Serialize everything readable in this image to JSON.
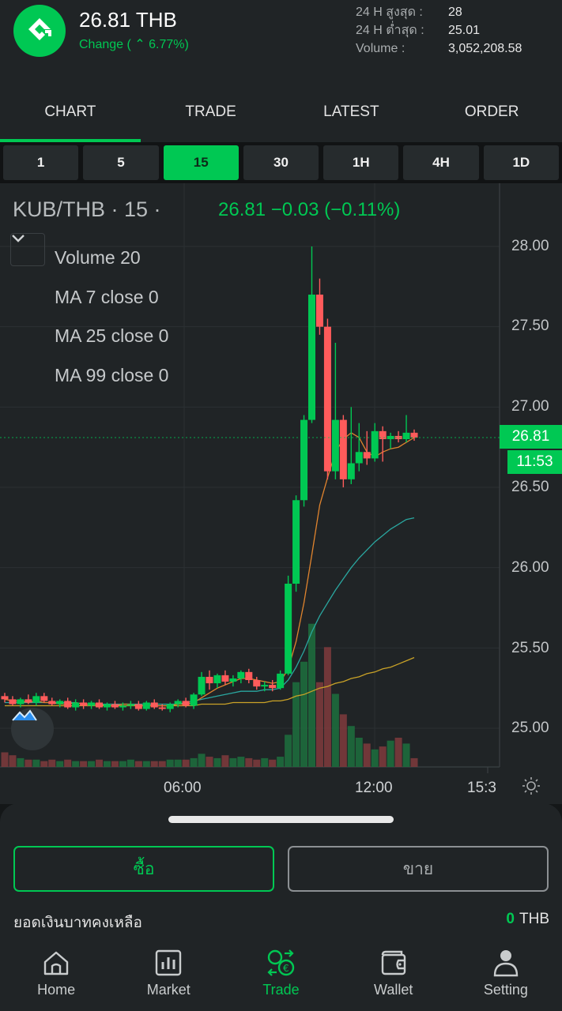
{
  "header": {
    "price": "26.81 THB",
    "change": "Change ( ⌃ 6.77%)",
    "stats": [
      {
        "label": "24 H สูงสุด :",
        "value": "28"
      },
      {
        "label": "24 H ต่ำสุด :",
        "value": "25.01"
      },
      {
        "label": "Volume :",
        "value": "3,052,208.58"
      }
    ]
  },
  "tabs": [
    {
      "label": "CHART",
      "active": true
    },
    {
      "label": "TRADE",
      "active": false
    },
    {
      "label": "LATEST",
      "active": false
    },
    {
      "label": "ORDER",
      "active": false
    }
  ],
  "intervals": [
    {
      "label": "1",
      "active": false
    },
    {
      "label": "5",
      "active": false
    },
    {
      "label": "15",
      "active": true
    },
    {
      "label": "30",
      "active": false
    },
    {
      "label": "1H",
      "active": false
    },
    {
      "label": "4H",
      "active": false
    },
    {
      "label": "1D",
      "active": false
    }
  ],
  "chart": {
    "symbol": "KUB/THB · 15 ·",
    "quote": "26.81  −0.03 (−0.11%)",
    "legend": [
      "Volume 20",
      "MA 7 close 0",
      "MA 25 close 0",
      "MA 99 close 0"
    ],
    "price_ticks": [
      "28.00",
      "27.50",
      "27.00",
      "26.50",
      "26.00",
      "25.50",
      "25.00"
    ],
    "last_price": "26.81",
    "countdown": "11:53",
    "time_ticks": [
      "06:00",
      "12:00",
      "15:3"
    ],
    "colors": {
      "up": "#00c853",
      "down": "#ff5b5b",
      "ma7": "#e0842e",
      "ma25": "#2aa7a0",
      "ma99": "#c9a227"
    }
  },
  "chart_data": {
    "type": "candlestick",
    "title": "KUB/THB",
    "interval": "15",
    "ylim": [
      24.75,
      28.15
    ],
    "y_ticks": [
      25.0,
      25.5,
      26.0,
      26.5,
      27.0,
      27.5,
      28.0
    ],
    "x_ticks": [
      "06:00",
      "12:00",
      "15:3"
    ],
    "last_price": 26.81,
    "candles": [
      [
        25.2,
        25.22,
        25.16,
        25.18
      ],
      [
        25.18,
        25.2,
        25.14,
        25.15
      ],
      [
        25.15,
        25.19,
        25.13,
        25.18
      ],
      [
        25.18,
        25.21,
        25.15,
        25.16
      ],
      [
        25.16,
        25.22,
        25.14,
        25.2
      ],
      [
        25.2,
        25.22,
        25.16,
        25.17
      ],
      [
        25.17,
        25.19,
        25.14,
        25.15
      ],
      [
        25.15,
        25.18,
        25.13,
        25.17
      ],
      [
        25.17,
        25.19,
        25.12,
        25.13
      ],
      [
        25.13,
        25.18,
        25.11,
        25.16
      ],
      [
        25.16,
        25.18,
        25.12,
        25.14
      ],
      [
        25.14,
        25.17,
        25.12,
        25.16
      ],
      [
        25.16,
        25.18,
        25.12,
        25.13
      ],
      [
        25.13,
        25.16,
        25.11,
        25.15
      ],
      [
        25.15,
        25.17,
        25.12,
        25.13
      ],
      [
        25.13,
        25.16,
        25.11,
        25.14
      ],
      [
        25.14,
        25.17,
        25.12,
        25.15
      ],
      [
        25.15,
        25.17,
        25.11,
        25.12
      ],
      [
        25.12,
        25.17,
        25.11,
        25.16
      ],
      [
        25.16,
        25.18,
        25.12,
        25.13
      ],
      [
        25.13,
        25.15,
        25.11,
        25.12
      ],
      [
        25.12,
        25.16,
        25.1,
        25.15
      ],
      [
        25.15,
        25.18,
        25.13,
        25.17
      ],
      [
        25.17,
        25.19,
        25.13,
        25.14
      ],
      [
        25.14,
        25.22,
        25.12,
        25.21
      ],
      [
        25.21,
        25.35,
        25.2,
        25.32
      ],
      [
        25.32,
        25.36,
        25.24,
        25.28
      ],
      [
        25.28,
        25.34,
        25.25,
        25.33
      ],
      [
        25.33,
        25.36,
        25.27,
        25.29
      ],
      [
        25.29,
        25.33,
        25.26,
        25.31
      ],
      [
        25.31,
        25.36,
        25.28,
        25.35
      ],
      [
        25.35,
        25.37,
        25.28,
        25.3
      ],
      [
        25.3,
        25.32,
        25.24,
        25.26
      ],
      [
        25.26,
        25.29,
        25.23,
        25.27
      ],
      [
        25.27,
        25.3,
        25.23,
        25.25
      ],
      [
        25.25,
        25.36,
        25.24,
        25.34
      ],
      [
        25.34,
        25.95,
        25.33,
        25.9
      ],
      [
        25.9,
        26.45,
        25.85,
        26.42
      ],
      [
        26.42,
        26.95,
        26.38,
        26.92
      ],
      [
        26.92,
        28.0,
        26.9,
        27.7
      ],
      [
        27.7,
        27.8,
        27.45,
        27.5
      ],
      [
        27.5,
        27.55,
        26.55,
        26.6
      ],
      [
        26.6,
        27.4,
        26.55,
        26.92
      ],
      [
        26.92,
        26.95,
        26.5,
        26.55
      ],
      [
        26.55,
        27.0,
        26.52,
        26.65
      ],
      [
        26.65,
        26.9,
        26.6,
        26.72
      ],
      [
        26.72,
        26.85,
        26.64,
        26.68
      ],
      [
        26.68,
        26.9,
        26.66,
        26.85
      ],
      [
        26.85,
        26.88,
        26.66,
        26.8
      ],
      [
        26.8,
        26.84,
        26.74,
        26.82
      ],
      [
        26.82,
        26.85,
        26.78,
        26.8
      ],
      [
        26.8,
        26.95,
        26.78,
        26.84
      ],
      [
        26.84,
        26.86,
        26.79,
        26.81
      ]
    ],
    "ma7": [
      25.18,
      25.17,
      25.17,
      25.16,
      25.17,
      25.16,
      25.16,
      25.15,
      25.15,
      25.16,
      25.15,
      25.15,
      25.15,
      25.14,
      25.14,
      25.15,
      25.15,
      25.14,
      25.14,
      25.14,
      25.14,
      25.14,
      25.15,
      25.15,
      25.16,
      25.19,
      25.22,
      25.25,
      25.27,
      25.29,
      25.31,
      25.31,
      25.3,
      25.29,
      25.28,
      25.29,
      25.37,
      25.54,
      25.78,
      26.08,
      26.39,
      26.56,
      26.72,
      26.8,
      26.84,
      26.81,
      26.72,
      26.69,
      26.72,
      26.74,
      26.75,
      26.78,
      26.81
    ],
    "ma25": [
      25.16,
      25.16,
      25.16,
      25.16,
      25.16,
      25.16,
      25.16,
      25.16,
      25.16,
      25.16,
      25.15,
      25.15,
      25.15,
      25.15,
      25.15,
      25.15,
      25.15,
      25.15,
      25.15,
      25.15,
      25.15,
      25.15,
      25.15,
      25.16,
      25.17,
      25.18,
      25.19,
      25.2,
      25.21,
      25.22,
      25.23,
      25.23,
      25.23,
      25.24,
      25.24,
      25.25,
      25.3,
      25.38,
      25.48,
      25.6,
      25.7,
      25.78,
      25.86,
      25.93,
      26.0,
      26.06,
      26.11,
      26.16,
      26.2,
      26.24,
      26.27,
      26.3,
      26.31
    ],
    "ma99": [
      25.14,
      25.14,
      25.14,
      25.14,
      25.14,
      25.14,
      25.14,
      25.14,
      25.14,
      25.14,
      25.14,
      25.14,
      25.14,
      25.14,
      25.14,
      25.14,
      25.14,
      25.14,
      25.14,
      25.14,
      25.14,
      25.14,
      25.14,
      25.14,
      25.14,
      25.15,
      25.15,
      25.15,
      25.15,
      25.16,
      25.16,
      25.16,
      25.16,
      25.16,
      25.17,
      25.17,
      25.18,
      25.2,
      25.21,
      25.23,
      25.25,
      25.26,
      25.28,
      25.29,
      25.31,
      25.32,
      25.34,
      25.35,
      25.37,
      25.38,
      25.4,
      25.42,
      25.44
    ],
    "volume_relative": [
      0.1,
      0.08,
      0.06,
      0.05,
      0.05,
      0.04,
      0.05,
      0.04,
      0.05,
      0.04,
      0.04,
      0.04,
      0.05,
      0.04,
      0.04,
      0.04,
      0.05,
      0.04,
      0.04,
      0.04,
      0.04,
      0.05,
      0.05,
      0.05,
      0.06,
      0.09,
      0.07,
      0.06,
      0.08,
      0.06,
      0.07,
      0.06,
      0.05,
      0.06,
      0.05,
      0.07,
      0.22,
      0.58,
      0.72,
      0.98,
      0.58,
      0.82,
      0.5,
      0.36,
      0.28,
      0.2,
      0.16,
      0.12,
      0.14,
      0.18,
      0.2,
      0.16,
      0.06
    ]
  },
  "panel": {
    "buy_label": "ซื้อ",
    "sell_label": "ขาย",
    "balance_label": "ยอดเงินบาทคงเหลือ",
    "balance_value": "0",
    "balance_unit": "THB"
  },
  "nav": [
    {
      "label": "Home",
      "icon": "home-icon",
      "active": false
    },
    {
      "label": "Market",
      "icon": "bar-chart-icon",
      "active": false
    },
    {
      "label": "Trade",
      "icon": "exchange-coins-icon",
      "active": true
    },
    {
      "label": "Wallet",
      "icon": "wallet-icon",
      "active": false
    },
    {
      "label": "Setting",
      "icon": "user-icon",
      "active": false
    }
  ]
}
